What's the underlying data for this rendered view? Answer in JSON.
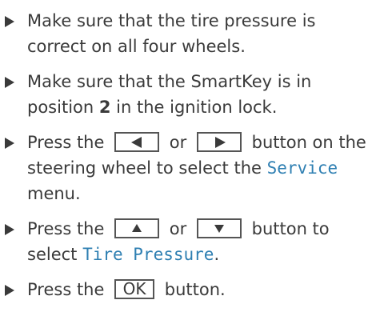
{
  "steps": [
    {
      "text_before": "Make sure that the tire pressure is correct on all four wheels."
    },
    {
      "text_before": "Make sure that the SmartKey is in position ",
      "bold": "2",
      "text_after": " in the ignition lock."
    },
    {
      "text_before": "Press the ",
      "key_left": "left-arrow-key",
      "between": " or ",
      "key_right": "right-arrow-key",
      "text_mid": " button on the steering wheel to select the ",
      "display": "Service",
      "text_after": " menu."
    },
    {
      "text_before": "Press the ",
      "key_up": "up-arrow-key",
      "between": " or ",
      "key_down": "down-arrow-key",
      "text_mid": " button to select ",
      "display": "Tire Pressure",
      "text_after": "."
    },
    {
      "text_before": "Press the ",
      "key_label": "OK",
      "text_after": " button."
    }
  ],
  "colors": {
    "text": "#3a3a3a",
    "display_text": "#2e7fb2",
    "key_border": "#555555"
  }
}
